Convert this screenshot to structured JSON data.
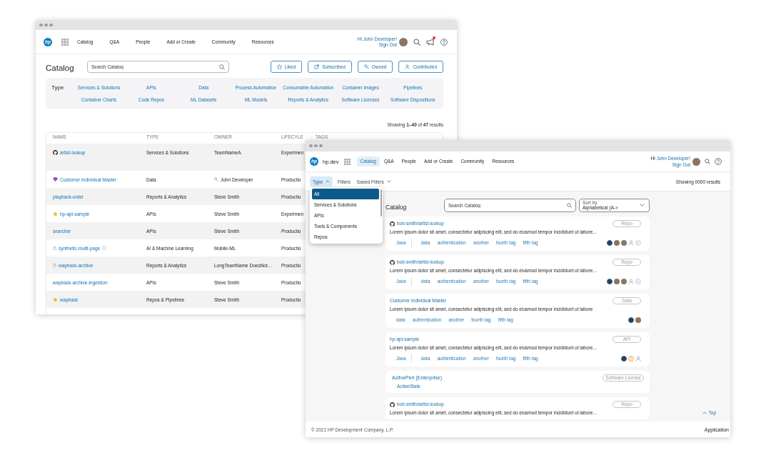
{
  "back_window": {
    "nav": {
      "logo": "hp",
      "items": [
        {
          "label": "Catalog"
        },
        {
          "label": "Q&A"
        },
        {
          "label": "People"
        },
        {
          "label": "Add or Create"
        },
        {
          "label": "Community"
        },
        {
          "label": "Resources"
        }
      ],
      "greeting": "Hi John Developer!",
      "sign_out": "Sign Out",
      "notifications_unread": true
    },
    "page_title": "Catalog",
    "search": {
      "placeholder": "Search Catalog"
    },
    "filter_buttons": [
      {
        "label": "Liked",
        "kind": "liked"
      },
      {
        "label": "Subscribed",
        "kind": "subscribed"
      },
      {
        "label": "Owned",
        "kind": "owned"
      },
      {
        "label": "Contributed",
        "kind": "contributed"
      }
    ],
    "type_filter": {
      "label": "Type",
      "options": [
        "Services & Solutions",
        "APIs",
        "Data",
        "Process Automation",
        "Consumable Automation",
        "Container Images",
        "Pipelines",
        "Container Charts",
        "Code Repos",
        "ML Datasets",
        "ML Models",
        "Reports & Analytics",
        "Software Licenses",
        "Software Dispositions"
      ]
    },
    "results": "Showing **1–40** of **47** results",
    "table": {
      "columns": [
        "NAME",
        "TYPE",
        "OWNER",
        "LIFECYLE",
        "TAGS"
      ],
      "rows": [
        {
          "kind": "repo",
          "name": "artist-lookup",
          "info": false,
          "type": "Services & Solutions",
          "owner": "TeamNameA",
          "owned_by_you": false,
          "lifecycle": "Experimen"
        },
        {
          "kind": "master_data",
          "name": "Customer Individual Master",
          "info": false,
          "type": "Data",
          "owner": "John Developer",
          "owned_by_you": true,
          "lifecycle": "Productio"
        },
        {
          "kind": "plain",
          "name": "playback-order",
          "info": false,
          "type": "Reports & Analytics",
          "owner": "Steve Smith",
          "owned_by_you": false,
          "lifecycle": "Productio"
        },
        {
          "kind": "favorite",
          "name": "hp-api-sample",
          "info": false,
          "type": "APIs",
          "owner": "Steve Smith",
          "owned_by_you": false,
          "lifecycle": "Experimen"
        },
        {
          "kind": "plain",
          "name": "searcher",
          "info": false,
          "type": "APIs",
          "owner": "Steve Smith",
          "owned_by_you": false,
          "lifecycle": "Productio"
        },
        {
          "kind": "private",
          "name": "synthetic-multi-page",
          "info": true,
          "type": "AI & Machine Learning",
          "owner": "Mobile-ML",
          "owned_by_you": false,
          "lifecycle": "Productio"
        },
        {
          "kind": "private",
          "name": "wayback-archive",
          "info": false,
          "type": "Reports & Analytics",
          "owner": "LongTeamName DoesNot...",
          "owned_by_you": false,
          "lifecycle": "Productio"
        },
        {
          "kind": "plain",
          "name": "wayback-archive-ingestion",
          "info": false,
          "type": "APIs",
          "owner": "Steve Smith",
          "owned_by_you": false,
          "lifecycle": "Productio"
        },
        {
          "kind": "favorite",
          "name": "wayback",
          "info": false,
          "type": "Repos & Pipelines",
          "owner": "Steve Smith",
          "owned_by_you": false,
          "lifecycle": "Productio"
        }
      ]
    }
  },
  "front_window": {
    "nav": {
      "logo": "hp",
      "site": "hp.dev",
      "items": [
        {
          "label": "Catalog",
          "selected": true
        },
        {
          "label": "Q&A",
          "selected": false
        },
        {
          "label": "People",
          "selected": false
        },
        {
          "label": "Add or Create",
          "selected": false
        },
        {
          "label": "Community",
          "selected": false
        },
        {
          "label": "Resources",
          "selected": false
        }
      ],
      "greeting": "Hi",
      "user": "John Developer!",
      "sign_out": "Sign Out"
    },
    "filter_bar": {
      "type": {
        "label": "Type",
        "expanded": true
      },
      "filters": "Filters",
      "saved_filters": "Saved Filters",
      "results": "Showing 0000 results"
    },
    "type_menu": [
      {
        "label": "All",
        "selected": true
      },
      {
        "label": "Services & Solutions",
        "selected": false
      },
      {
        "label": "APIs",
        "selected": false
      },
      {
        "label": "Tools & Components",
        "selected": false
      },
      {
        "label": "Repos",
        "selected": false
      }
    ],
    "page_title": "Catalog",
    "search": {
      "placeholder": "Search Catalog"
    },
    "sort": {
      "label": "Sort by",
      "value": "Alphabetical (A->"
    },
    "cards": [
      {
        "kind": "repo",
        "title": "bob-smith/artist-lookup",
        "badge": "Repo",
        "description": "Lorem ipsum dolor sit amet, consectetur adipiscing elit, sed do eiusmod tempor incididunt ut labore...",
        "language": "Java",
        "tags": [
          "data",
          "authentication",
          "another",
          "fourth tag",
          "fifth tag"
        ],
        "contributors": [
          {
            "kind": "avatar",
            "outlined": true
          },
          {
            "kind": "avatar",
            "outlined": false
          },
          {
            "kind": "avatar",
            "outlined": false
          },
          {
            "kind": "person",
            "outlined": false
          },
          {
            "kind": "add",
            "outlined": false
          }
        ]
      },
      {
        "kind": "repo",
        "title": "bob-smith/artist-lookup",
        "badge": "Repo",
        "description": "Lorem ipsum dolor sit amet, consectetur adipiscing elit, sed do eiusmod tempor incididunt ut labore...",
        "language": "Java",
        "tags": [
          "data",
          "authentication",
          "another",
          "fourth tag",
          "fifth tag"
        ],
        "contributors": [
          {
            "kind": "avatar",
            "outlined": true
          },
          {
            "kind": "avatar",
            "outlined": false
          },
          {
            "kind": "avatar",
            "outlined": false
          },
          {
            "kind": "person",
            "outlined": false
          },
          {
            "kind": "add",
            "outlined": false
          }
        ]
      },
      {
        "kind": "item",
        "title": "Customer Individual Master",
        "badge": "Data",
        "description": "Lorem ipsum dolor sit amet, consectetur adipiscing elit, sed do eiusmod tempor incididunt ut labore",
        "tags": [
          "data",
          "authentication",
          "another",
          "fourth tag",
          "fifth tag"
        ],
        "contributors": [
          {
            "kind": "avatar",
            "outlined": true
          },
          {
            "kind": "avatar",
            "outlined": false
          }
        ]
      },
      {
        "kind": "item",
        "title": "hp-api-sample",
        "badge": "API",
        "description": "Lorem ipsum dolor sit amet, consectetur adipiscing elit, sed do eiusmod tempor incididunt ut labore...",
        "language": "Java",
        "tags": [
          "data",
          "authentication",
          "another",
          "fourth tag",
          "fifth tag"
        ],
        "contributors": [
          {
            "kind": "avatar",
            "outlined": true
          },
          {
            "kind": "alert",
            "outlined": false
          },
          {
            "kind": "person",
            "outlined": false
          }
        ]
      },
      {
        "kind": "license",
        "title": "AcitvePerl (Enterprise)",
        "badge": "Software License",
        "vendor": "ActiveState"
      },
      {
        "kind": "repo",
        "title": "bob-smith/artist-lookup",
        "badge": "Repo",
        "description": "Lorem ipsum dolor sit amet, consectetur adipiscing elit, sed do eiusmod tempor incididunt ut labore..."
      }
    ],
    "back_to_top": "Top",
    "footer": {
      "copyright": "© 2021 HP Development Company, L.P.",
      "app": "Application"
    }
  }
}
